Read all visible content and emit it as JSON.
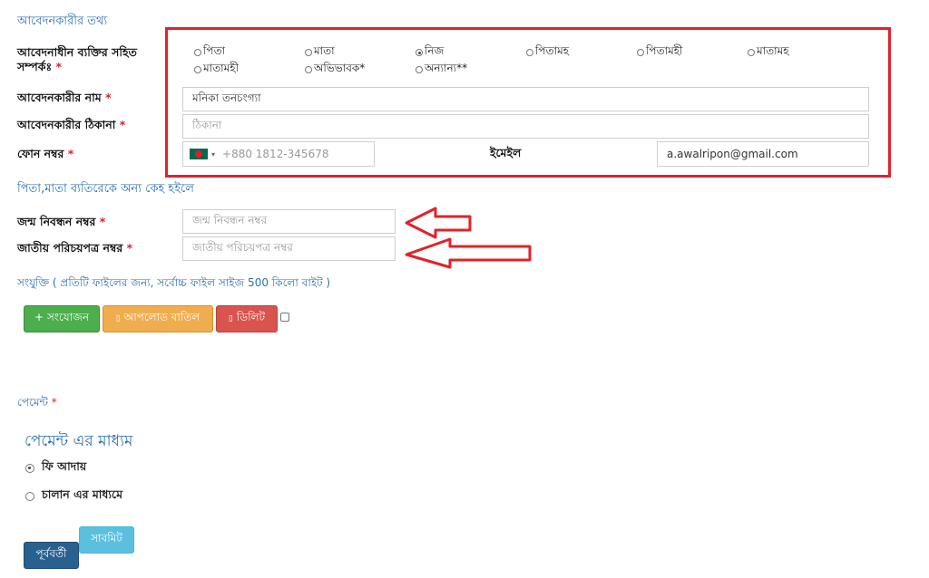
{
  "applicant_info": {
    "title": "আবেদনকারীর তথ্য",
    "relation_label": "আবেদনাধীন ব্যক্তির সহিত সম্পর্কঃ",
    "relation_options": [
      "পিতা",
      "মাতা",
      "নিজ",
      "পিতামহ",
      "পিতামহী",
      "মাতামহ",
      "মাতামহী",
      "অভিভাবক*",
      "অন্যান্য**"
    ],
    "relation_selected": "নিজ",
    "name_label": "আবেদনকারীর নাম",
    "name_value": "মনিকা তনচংগ্যা",
    "address_label": "আবেদনকারীর ঠিকানা",
    "address_placeholder": "ঠিকানা",
    "phone_label": "ফোন নম্বর",
    "phone_placeholder": "+880 1812-345678",
    "email_label": "ইমেইল",
    "email_value": "a.awalripon@gmail.com"
  },
  "other_section": {
    "title": "পিতা,মাতা ব্যতিরেকে অন্য কেহ হইলে",
    "birth_reg_label": "জন্ম নিবন্ধন নম্বর",
    "birth_reg_placeholder": "জন্ম নিবন্ধন নম্বর",
    "nid_label": "জাতীয় পরিচয়পত্র নম্বর",
    "nid_placeholder": "জাতীয় পরিচয়পত্র নম্বর"
  },
  "attachment": {
    "title": "সংযুক্তি ( প্রতিটি ফাইলের জন্য, সর্বোচ্চ ফাইল সাইজ 500 কিলো বাইট )",
    "add_button": "+ সংযোজন",
    "cancel_upload_button": "আপলোড বাতিল",
    "delete_button": "ডিলিট"
  },
  "payment": {
    "label": "পেমেন্ট",
    "method_title": "পেমেন্ট এর মাধ্যম",
    "options": [
      "ফি আদায়",
      "চালান এর মাধ্যমে"
    ],
    "selected": "ফি আদায়"
  },
  "nav": {
    "previous_button": "পূর্ববর্তী",
    "submit_button": "সাবমিট"
  },
  "required_mark": "*",
  "colors": {
    "annotation_red": "#e1222a",
    "section_blue": "#2c6fb0",
    "add_green": "#4cae4c",
    "cancel_orange": "#f0ad4e",
    "delete_red": "#d9534f",
    "prev_blue": "#286090",
    "submit_cyan": "#5bc0de"
  }
}
